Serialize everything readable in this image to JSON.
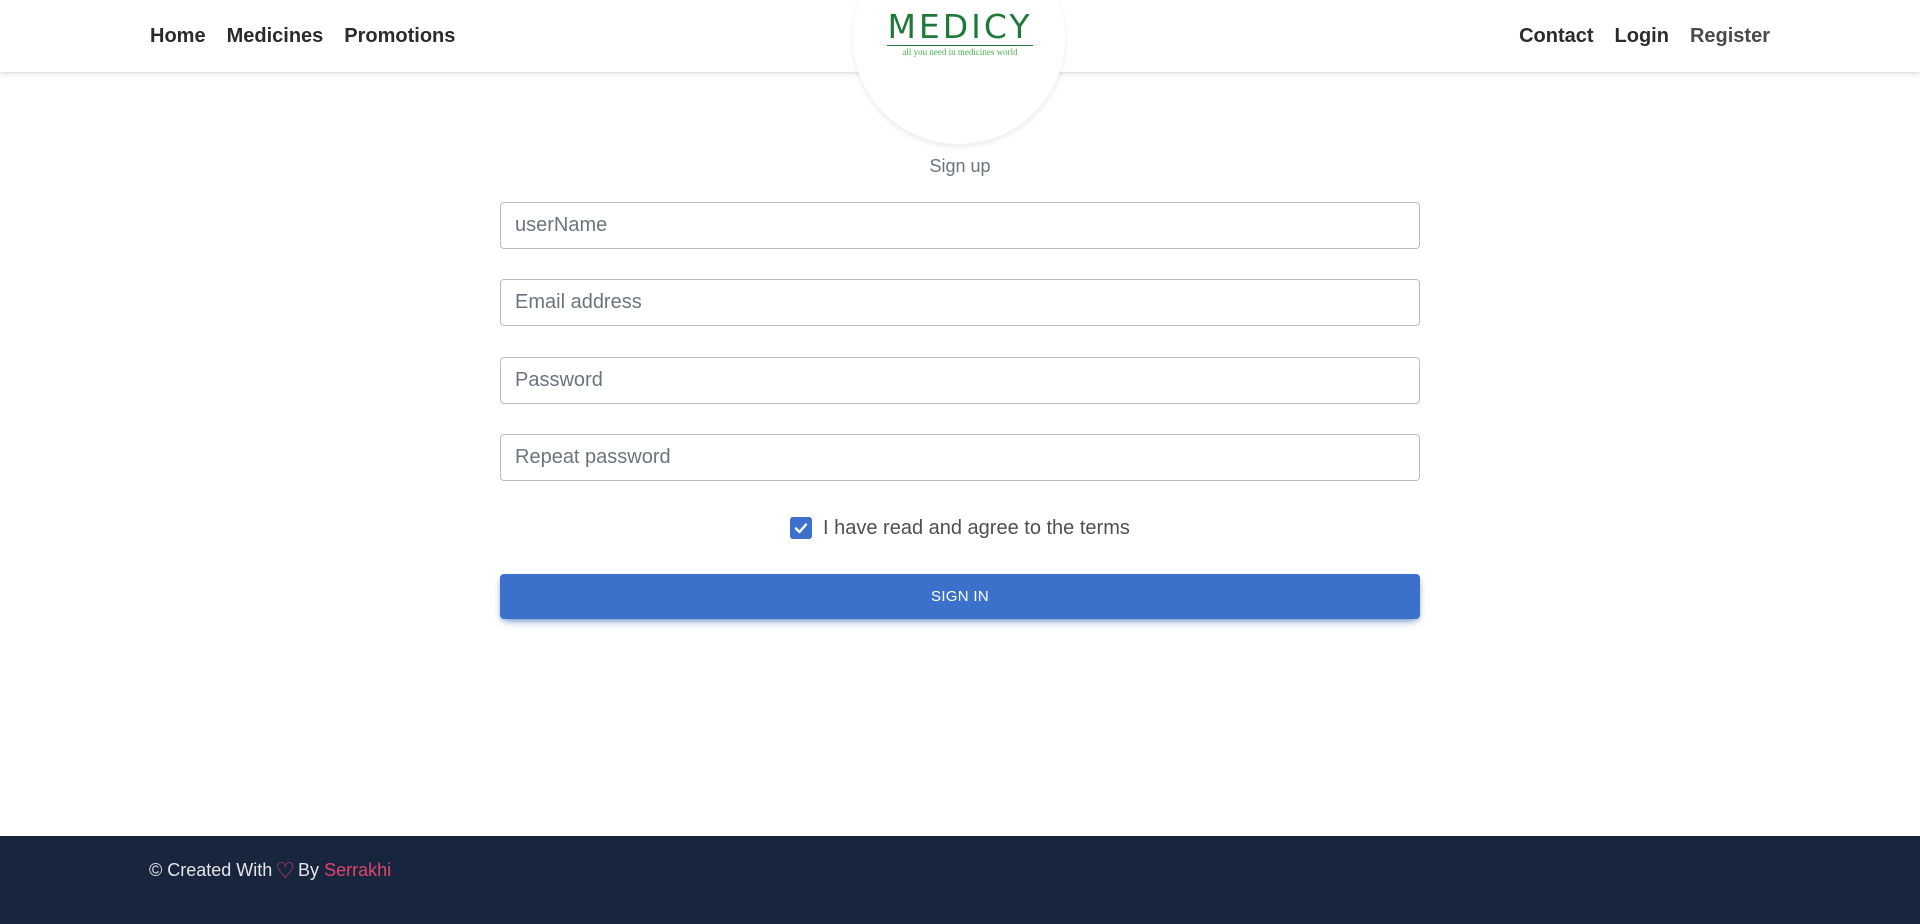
{
  "nav": {
    "left": [
      "Home",
      "Medicines",
      "Promotions"
    ],
    "right": [
      "Contact",
      "Login",
      "Register"
    ]
  },
  "logo": {
    "title": "MEDICY",
    "tagline": "all you need in medicines world",
    "color": "#1f7a3a"
  },
  "form": {
    "title": "Sign up",
    "fields": [
      {
        "placeholder": "userName",
        "value": ""
      },
      {
        "placeholder": "Email address",
        "value": ""
      },
      {
        "placeholder": "Password",
        "value": ""
      },
      {
        "placeholder": "Repeat password",
        "value": ""
      }
    ],
    "terms_label": "I have read and agree to the terms",
    "terms_checked": true,
    "submit_label": "SIGN IN"
  },
  "footer": {
    "prefix": "© Created With",
    "heart_icon": "heart-outline-icon",
    "by": "By",
    "author": "Serrakhi"
  },
  "colors": {
    "primary": "#3b71ca",
    "footer_bg": "#18253f",
    "accent": "#e0456a"
  }
}
